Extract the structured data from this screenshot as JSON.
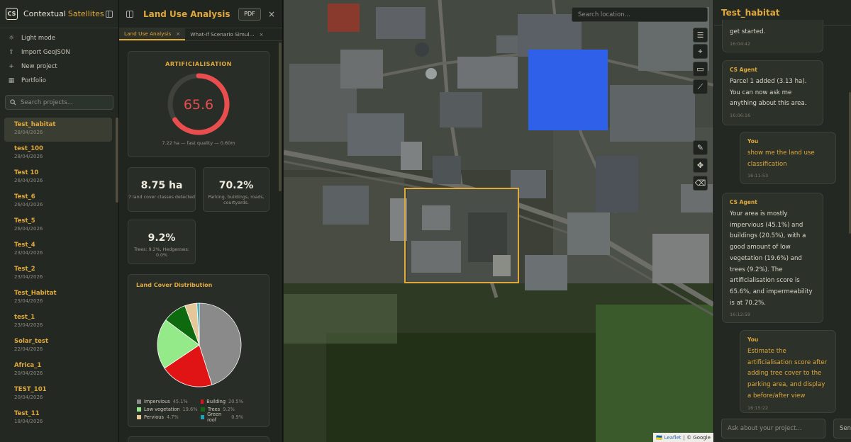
{
  "brand": {
    "logo": "CS",
    "name": "Contextual",
    "accent": "Satellites"
  },
  "menu": [
    {
      "icon": "sun-icon",
      "glyph": "☼",
      "label": "Light mode"
    },
    {
      "icon": "upload-icon",
      "glyph": "⇪",
      "label": "Import GeoJSON"
    },
    {
      "icon": "plus-icon",
      "glyph": "+",
      "label": "New project"
    },
    {
      "icon": "grid-icon",
      "glyph": "▦",
      "label": "Portfolio"
    }
  ],
  "search": {
    "placeholder": "Search projects..."
  },
  "projects": [
    {
      "name": "Test_habitat",
      "date": "28/04/2026",
      "active": true
    },
    {
      "name": "test_100",
      "date": "28/04/2026"
    },
    {
      "name": "Test 10",
      "date": "26/04/2026"
    },
    {
      "name": "Test_6",
      "date": "26/04/2026"
    },
    {
      "name": "Test_5",
      "date": "26/04/2026"
    },
    {
      "name": "Test_4",
      "date": "23/04/2026"
    },
    {
      "name": "Test_2",
      "date": "23/04/2026"
    },
    {
      "name": "Test_Habitat",
      "date": "23/04/2026"
    },
    {
      "name": "test_1",
      "date": "23/04/2026"
    },
    {
      "name": "Solar_test",
      "date": "22/04/2026"
    },
    {
      "name": "Africa_1",
      "date": "20/04/2026"
    },
    {
      "name": "TEST_101",
      "date": "20/04/2026"
    },
    {
      "name": "Test_11",
      "date": "18/04/2026"
    }
  ],
  "panel": {
    "title": "Land Use Analysis",
    "pdf_label": "PDF",
    "close": "×",
    "tabs": [
      {
        "label": "Land Use Analysis",
        "close": "×",
        "active": true
      },
      {
        "label": "What-If Scenario Simul...",
        "close": "×"
      }
    ],
    "artificialisation": {
      "title": "ARTIFICIALISATION",
      "value": "65.6",
      "score": 65.6,
      "max": 100,
      "subtitle": "7.22 ha — fast quality — 0.60m",
      "color": "#ea4d4d"
    },
    "stats": [
      {
        "value": "8.75 ha",
        "label": "7 land cover classes detected"
      },
      {
        "value": "70.2%",
        "label": "Parking, buildings, roads, courtyards."
      },
      {
        "value": "9.2%",
        "label": "Trees: 9.2%, Hedgerows: 0.0%"
      }
    ],
    "distribution_title": "Land Cover Distribution"
  },
  "chart_data": {
    "type": "pie",
    "title": "Land Cover Distribution",
    "slices": [
      {
        "label": "Impervious",
        "value": 45.1,
        "pct": "45.1%",
        "color": "#8a8a8a"
      },
      {
        "label": "Building",
        "value": 20.5,
        "pct": "20.5%",
        "color": "#e01414"
      },
      {
        "label": "Low vegetation",
        "value": 19.6,
        "pct": "19.6%",
        "color": "#94ea88"
      },
      {
        "label": "Trees",
        "value": 9.2,
        "pct": "9.2%",
        "color": "#0e6a0e"
      },
      {
        "label": "Pervious",
        "value": 4.7,
        "pct": "4.7%",
        "color": "#e6c79a"
      },
      {
        "label": "Green roof",
        "value": 0.9,
        "pct": "0.9%",
        "color": "#22a3b5"
      }
    ],
    "legend": "bottom"
  },
  "map": {
    "search_placeholder": "Search location...",
    "tools": [
      "layers-icon",
      "pin-icon",
      "polygon-icon",
      "measure-icon",
      "draw-icon",
      "move-icon",
      "eraser-icon"
    ],
    "attribution_prefix": "🇺🇦",
    "attribution_link": "Leaflet",
    "attribution_rest": "| © Google"
  },
  "chat": {
    "title": "Test_habitat",
    "messages": [
      {
        "who": "",
        "text": "get started.",
        "time": "16:04:42",
        "user": false
      },
      {
        "who": "CS Agent",
        "text": "Parcel 1 added (3.13 ha). You can now ask me anything about this area.",
        "time": "16:06:16",
        "user": false
      },
      {
        "who": "You",
        "text": "show me the land use classification",
        "time": "16:11:53",
        "user": true
      },
      {
        "who": "CS Agent",
        "text": "Your area is mostly impervious (45.1%) and buildings (20.5%), with a good amount of low vegetation (19.6%) and trees (9.2%). The artificialisation score is 65.6%, and impermeability is at 70.2%.",
        "time": "16:12:59",
        "user": false
      },
      {
        "who": "You",
        "text": "Estimate the artificialisation score after adding tree cover to the parking area, and display a before/after view",
        "time": "16:15:22",
        "user": true
      }
    ],
    "input_placeholder": "Ask about your project...",
    "send_label": "Sen"
  }
}
